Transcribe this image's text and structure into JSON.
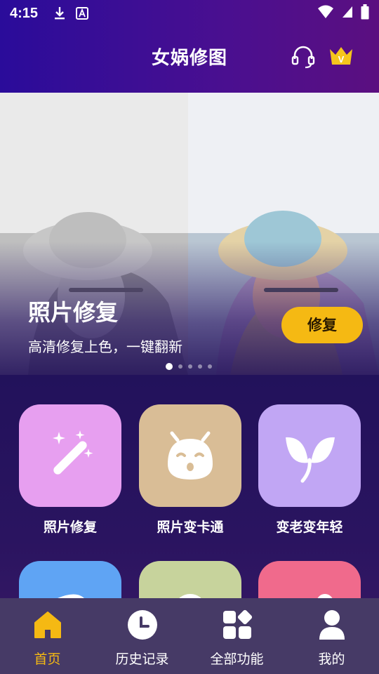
{
  "status_bar": {
    "time": "4:15"
  },
  "header": {
    "title": "女娲修图",
    "vip_badge_letter": "V"
  },
  "banner": {
    "title": "照片修复",
    "subtitle": "高清修复上色，一键翻新",
    "button_label": "修复",
    "page_count": 5,
    "active_page": 1
  },
  "features": [
    {
      "label": "照片修复",
      "icon": "magic-wand-icon",
      "color": "#e79ff0"
    },
    {
      "label": "照片变卡通",
      "icon": "cartoon-face-icon",
      "color": "#d9bd96"
    },
    {
      "label": "变老变年轻",
      "icon": "leaf-icon",
      "color": "#c1a6f4"
    },
    {
      "label": "",
      "icon": "partial-icon",
      "color": "#5fa4f4"
    },
    {
      "label": "",
      "icon": "partial-icon",
      "color": "#c7d39c"
    },
    {
      "label": "",
      "icon": "partial-icon",
      "color": "#f06a8c"
    }
  ],
  "bottom_nav": [
    {
      "label": "首页",
      "icon": "home-icon",
      "active": true
    },
    {
      "label": "历史记录",
      "icon": "clock-icon",
      "active": false
    },
    {
      "label": "全部功能",
      "icon": "grid-icon",
      "active": false
    },
    {
      "label": "我的",
      "icon": "user-icon",
      "active": false
    }
  ],
  "colors": {
    "accent": "#f5b913",
    "nav_bg": "#463a66"
  }
}
